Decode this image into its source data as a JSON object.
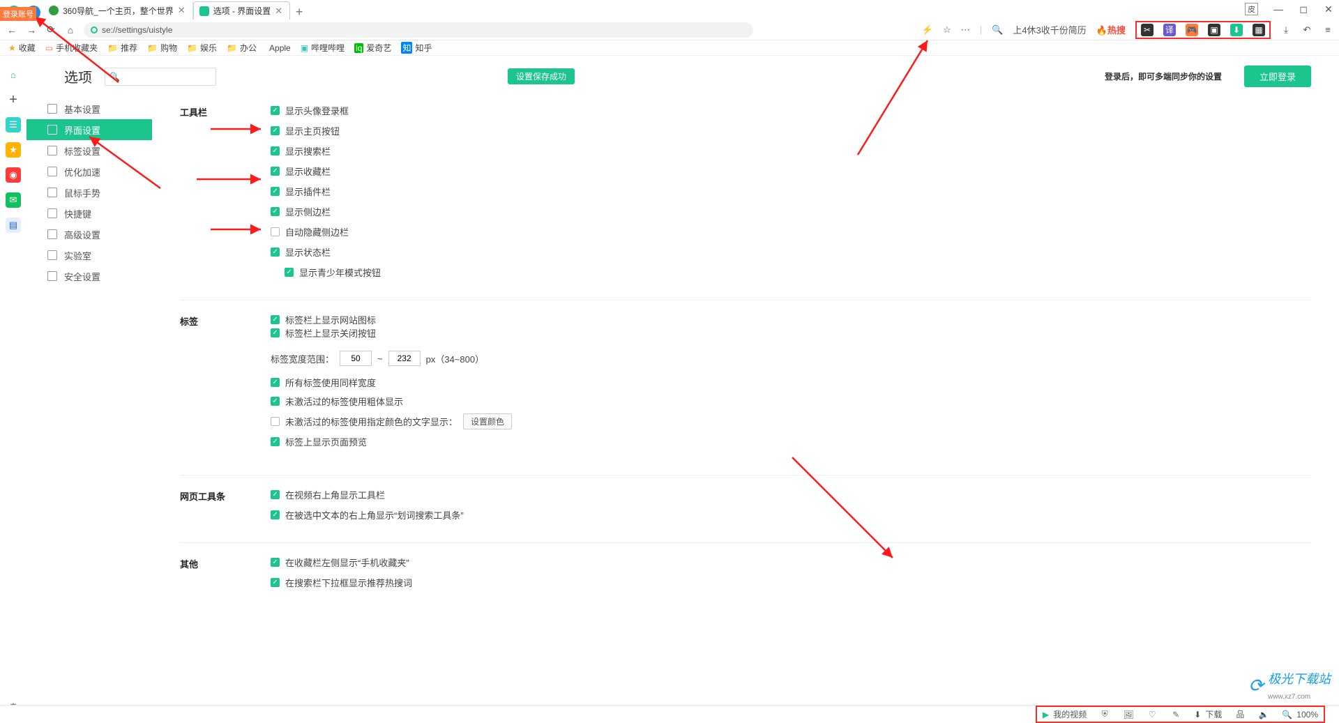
{
  "window": {
    "skin_badge": "皮",
    "controls": [
      "minimize",
      "maximize",
      "close"
    ]
  },
  "tabs": [
    {
      "favicon": "green360",
      "title": "360导航_一个主页，整个世界"
    },
    {
      "favicon": "green",
      "title": "选项 - 界面设置",
      "active": true
    }
  ],
  "address": {
    "url": "se://settings/uistyle",
    "search_placeholder": "上4休3收千份简历",
    "hot_label": "热搜"
  },
  "login_badge": "登录账号",
  "bookmarks": [
    "收藏",
    "手机收藏夹",
    "推荐",
    "购物",
    "娱乐",
    "办公",
    "Apple",
    "哔哩哔哩",
    "爱奇艺",
    "知乎"
  ],
  "options": {
    "title": "选项",
    "save_banner": "设置保存成功",
    "sync_text_1": "登录后，即可多端同步你的设置",
    "login_btn": "立即登录",
    "nav": [
      "基本设置",
      "界面设置",
      "标签设置",
      "优化加速",
      "鼠标手势",
      "快捷键",
      "高级设置",
      "实验室",
      "安全设置"
    ],
    "active_nav_index": 1,
    "sections": {
      "toolbar": {
        "title": "工具栏",
        "items": [
          {
            "label": "显示头像登录框",
            "checked": true
          },
          {
            "label": "显示主页按钮",
            "checked": true
          },
          {
            "label": "显示搜索栏",
            "checked": true
          },
          {
            "label": "显示收藏栏",
            "checked": true
          },
          {
            "label": "显示插件栏",
            "checked": true
          },
          {
            "label": "显示侧边栏",
            "checked": true
          },
          {
            "label": "自动隐藏侧边栏",
            "checked": false
          },
          {
            "label": "显示状态栏",
            "checked": true
          },
          {
            "label": "显示青少年模式按钮",
            "checked": true,
            "sub": true
          }
        ]
      },
      "tabs": {
        "title": "标签",
        "items": [
          {
            "label": "标签栏上显示网站图标",
            "checked": true
          },
          {
            "label": "标签栏上显示关闭按钮",
            "checked": true
          }
        ],
        "range_label": "标签宽度范围：",
        "range_min": "50",
        "range_max": "232",
        "range_suffix": "px（34~800）",
        "items2": [
          {
            "label": "所有标签使用同样宽度",
            "checked": true
          },
          {
            "label": "未激活过的标签使用粗体显示",
            "checked": true
          },
          {
            "label": "未激活过的标签使用指定颜色的文字显示：",
            "checked": false,
            "btn": "设置颜色"
          },
          {
            "label": "标签上显示页面预览",
            "checked": true
          }
        ]
      },
      "webbar": {
        "title": "网页工具条",
        "items": [
          {
            "label": "在视频右上角显示工具栏",
            "checked": true
          },
          {
            "label": "在被选中文本的右上角显示“划词搜索工具条”",
            "checked": true
          }
        ]
      },
      "other": {
        "title": "其他",
        "items": [
          {
            "label": "在收藏栏左侧显示“手机收藏夹”",
            "checked": true
          },
          {
            "label": "在搜索栏下拉框显示推荐热搜词",
            "checked": true
          }
        ]
      }
    }
  },
  "status": {
    "my_video": "我的视频",
    "download": "下载",
    "volume": "volume",
    "zoom": "100%"
  },
  "watermark": {
    "name": "极光下载站",
    "url": "www.xz7.com"
  }
}
